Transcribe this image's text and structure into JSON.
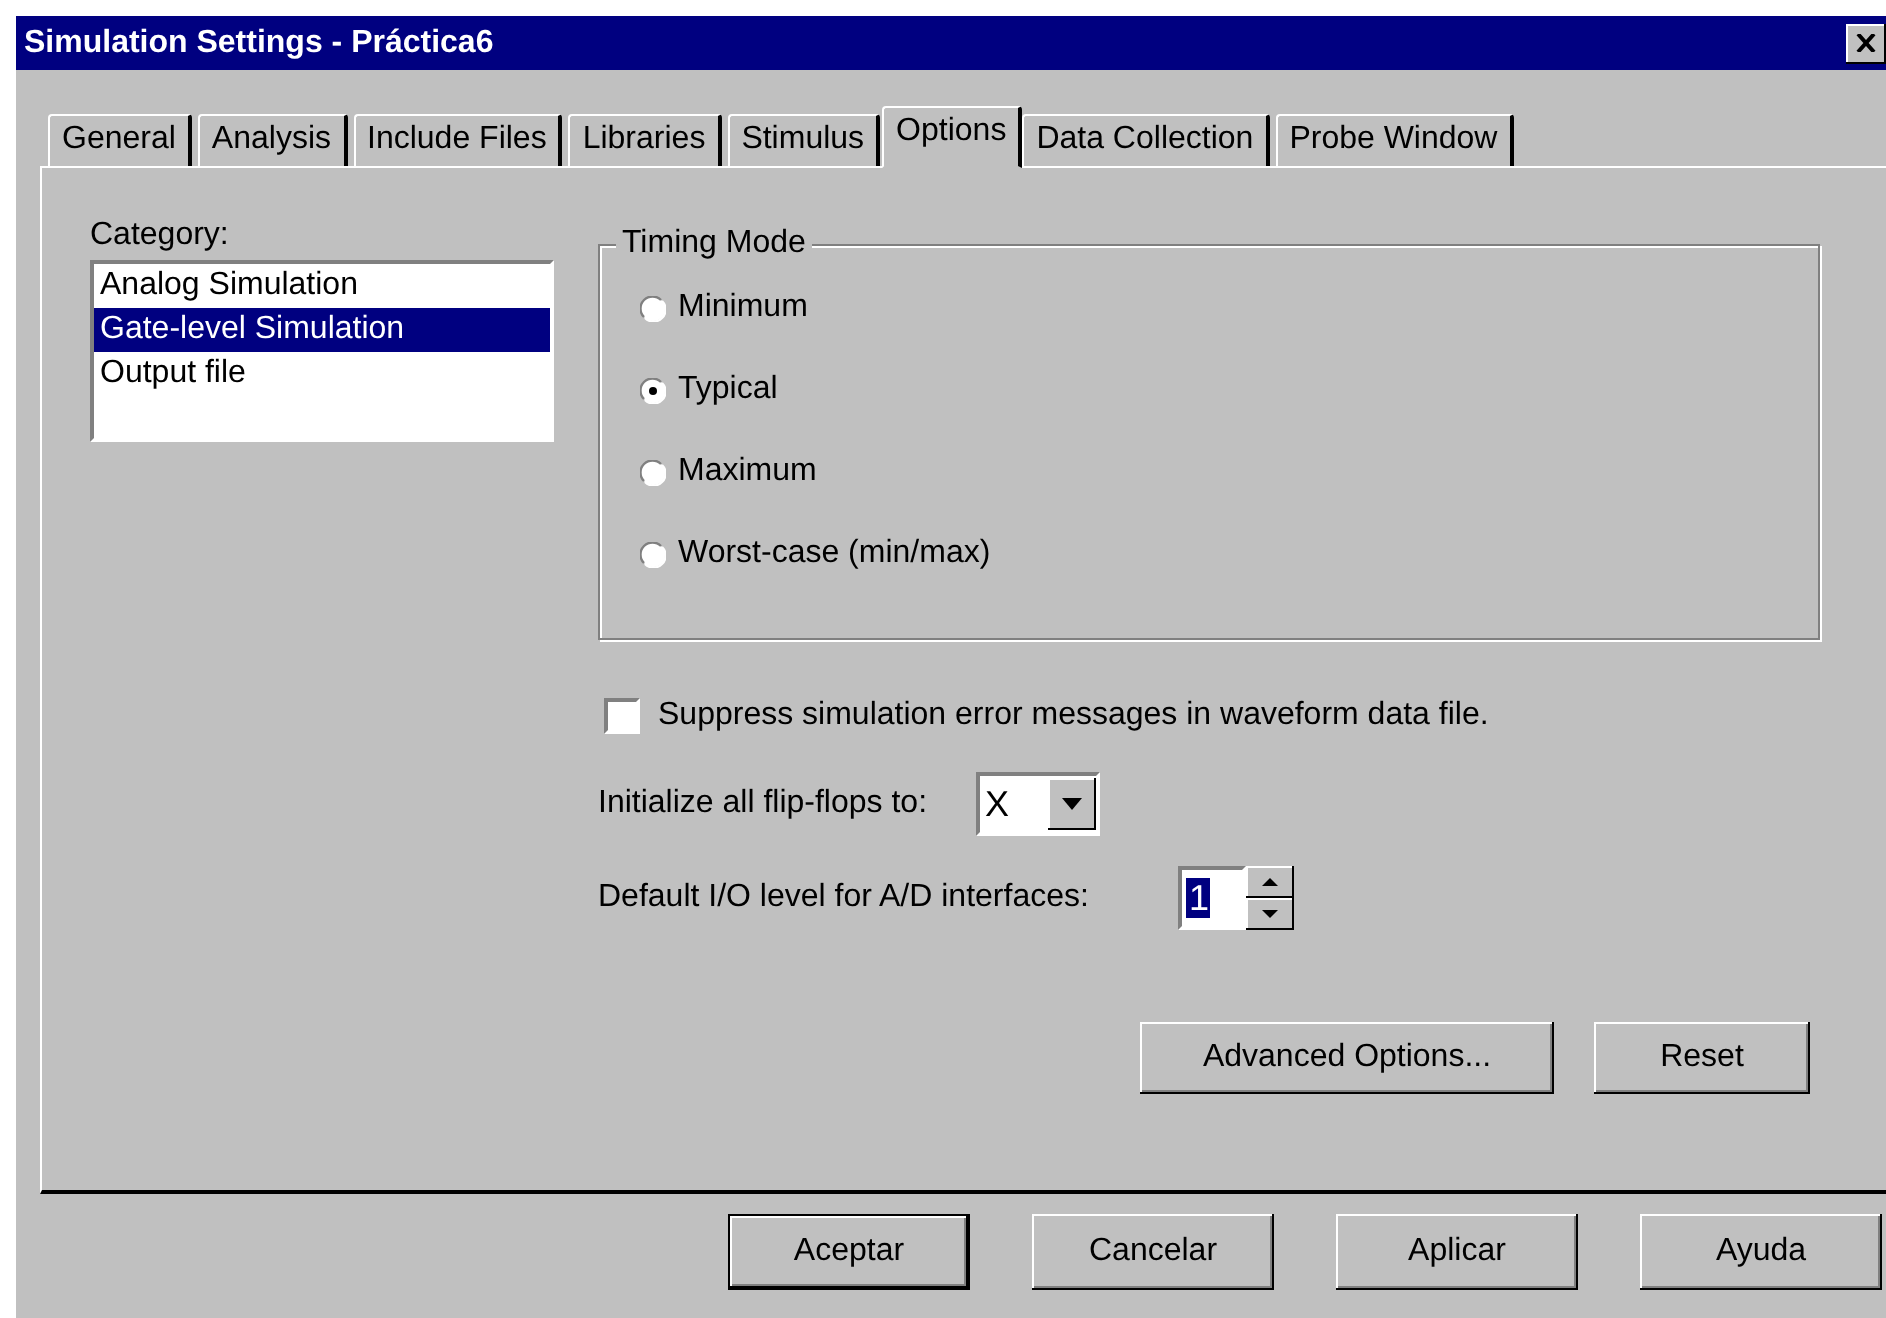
{
  "window": {
    "title": "Simulation Settings - Práctica6"
  },
  "tabs": [
    {
      "label": "General",
      "selected": false
    },
    {
      "label": "Analysis",
      "selected": false
    },
    {
      "label": "Include Files",
      "selected": false
    },
    {
      "label": "Libraries",
      "selected": false
    },
    {
      "label": "Stimulus",
      "selected": false
    },
    {
      "label": "Options",
      "selected": true
    },
    {
      "label": "Data Collection",
      "selected": false
    },
    {
      "label": "Probe Window",
      "selected": false
    }
  ],
  "category": {
    "label": "Category:",
    "items": [
      {
        "label": "Analog Simulation",
        "selected": false
      },
      {
        "label": "Gate-level Simulation",
        "selected": true
      },
      {
        "label": "Output file",
        "selected": false
      }
    ]
  },
  "timing_mode": {
    "title": "Timing Mode",
    "options": [
      {
        "label": "Minimum",
        "selected": false
      },
      {
        "label": "Typical",
        "selected": true
      },
      {
        "label": "Maximum",
        "selected": false
      },
      {
        "label": "Worst-case (min/max)",
        "selected": false
      }
    ]
  },
  "suppress_errors": {
    "label": "Suppress simulation error messages in waveform data file.",
    "checked": false
  },
  "init_flipflops": {
    "label": "Initialize all flip-flops to:",
    "value": "X"
  },
  "default_io_level": {
    "label": "Default I/O level for A/D interfaces:",
    "value": "1",
    "highlighted": true
  },
  "panel_buttons": [
    {
      "label": "Advanced Options..."
    },
    {
      "label": "Reset"
    }
  ],
  "buttons": [
    {
      "label": "Aceptar",
      "default": true
    },
    {
      "label": "Cancelar",
      "default": false
    },
    {
      "label": "Aplicar",
      "default": false
    },
    {
      "label": "Ayuda",
      "default": false
    }
  ]
}
